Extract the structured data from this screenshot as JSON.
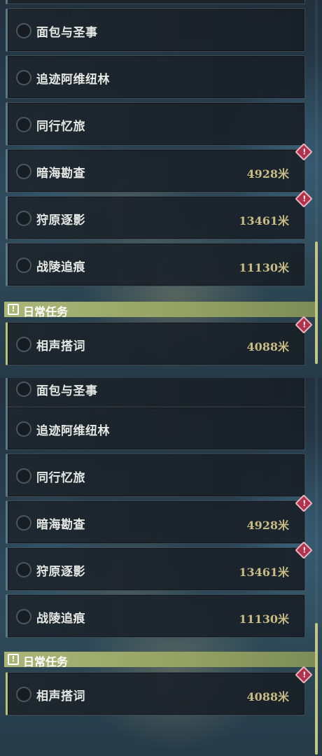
{
  "panels": [
    {
      "quests": [
        {
          "name": "面包与圣事",
          "distance": "",
          "alert": false
        },
        {
          "name": "追迹阿维纽林",
          "distance": "",
          "alert": false
        },
        {
          "name": "同行忆旅",
          "distance": "",
          "alert": false
        },
        {
          "name": "暗海勘查",
          "distance": "4928米",
          "alert": true
        },
        {
          "name": "狩原逐影",
          "distance": "13461米",
          "alert": true
        },
        {
          "name": "战陵追痕",
          "distance": "11130米",
          "alert": false
        }
      ],
      "section": {
        "title": "日常任务",
        "icon": "exclamation-icon",
        "icon_glyph": "!"
      },
      "daily": {
        "name": "相声搭词",
        "distance": "4088米",
        "alert": true
      }
    },
    {
      "quests": [
        {
          "name": "面包与圣事",
          "distance": "",
          "alert": false
        },
        {
          "name": "追迹阿维纽林",
          "distance": "",
          "alert": false
        },
        {
          "name": "同行忆旅",
          "distance": "",
          "alert": false
        },
        {
          "name": "暗海勘查",
          "distance": "4928米",
          "alert": true
        },
        {
          "name": "狩原逐影",
          "distance": "13461米",
          "alert": true
        },
        {
          "name": "战陵追痕",
          "distance": "11130米",
          "alert": false
        }
      ],
      "section": {
        "title": "日常任务",
        "icon": "exclamation-icon",
        "icon_glyph": "!"
      },
      "daily": {
        "name": "相声搭词",
        "distance": "4088米",
        "alert": true
      }
    }
  ],
  "alert_glyph": "!",
  "colors": {
    "accent": "#b9c37a",
    "alert": "#b0324c",
    "distance": "#c9bc85"
  }
}
